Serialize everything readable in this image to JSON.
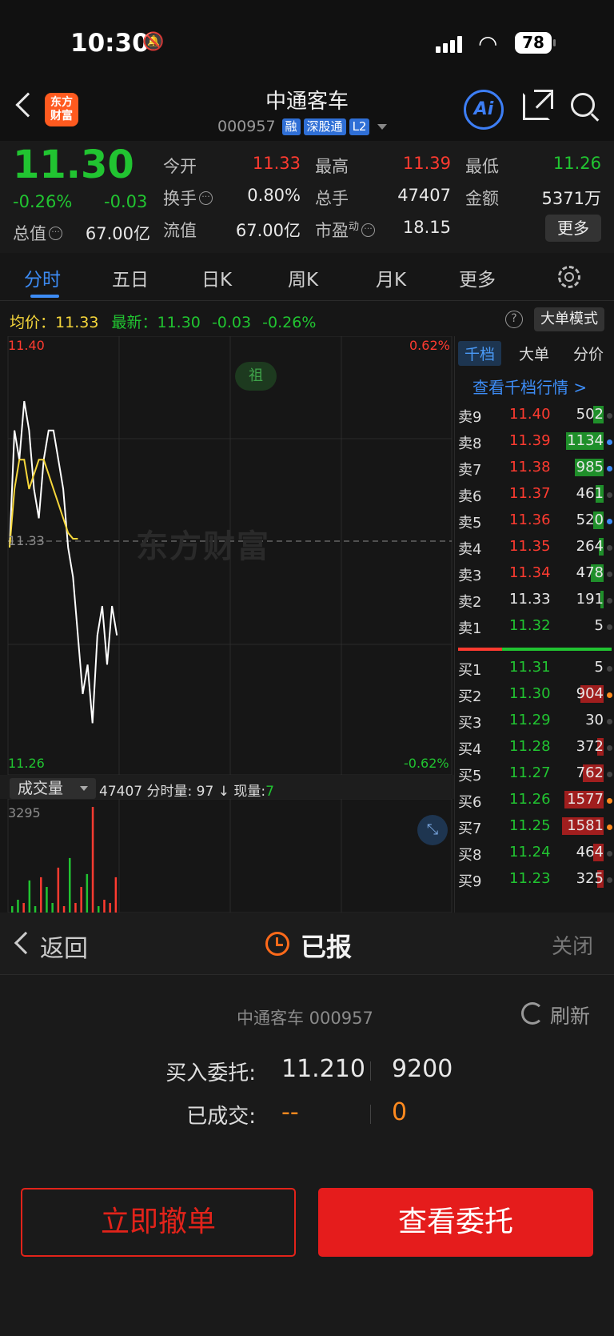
{
  "status_bar": {
    "time": "10:30",
    "battery": "78"
  },
  "header": {
    "logo_top": "东方",
    "logo_bottom": "财富",
    "stock_name": "中通客车",
    "stock_code": "000957",
    "tags": [
      "融",
      "深股通",
      "L2"
    ],
    "ai_label": "Ai"
  },
  "quote": {
    "price": "11.30",
    "change_pct": "-0.26%",
    "change": "-0.03",
    "total_value_label": "总值",
    "total_value": "67.00亿",
    "float_value_label": "流值",
    "float_value": "67.00亿",
    "pe_label": "市盈",
    "pe_sup": "动",
    "pe": "18.15",
    "open_label": "今开",
    "open": "11.33",
    "high_label": "最高",
    "high": "11.39",
    "low_label": "最低",
    "low": "11.26",
    "turnover_label": "换手",
    "turnover": "0.80%",
    "volume_label": "总手",
    "volume": "47407",
    "amount_label": "金额",
    "amount": "5371万",
    "more_label": "更多"
  },
  "tabs": [
    "分时",
    "五日",
    "日K",
    "周K",
    "月K",
    "更多"
  ],
  "avg_row": {
    "avg_label": "均价：",
    "avg_value": "11.33",
    "latest_label": "最新：",
    "latest_value": "11.30",
    "latest_change": "-0.03",
    "latest_pct": "-0.26%",
    "help": "?",
    "big_order_mode": "大单模式"
  },
  "chart": {
    "y_top": "11.40",
    "y_mid": "11.33",
    "y_bottom": "11.26",
    "pct_top": "0.62%",
    "pct_bottom": "-0.62%",
    "badge": "祖",
    "watermark": "东方财富",
    "volume_selector": "成交量",
    "volume_total": "47407",
    "minute_vol_label": "分时量:",
    "minute_vol": "97",
    "arrow": "↓",
    "now_vol_label": "现量:",
    "now_vol": "7",
    "vol_max": "3295",
    "colors": {
      "price_line": "#ffffff",
      "avg_line": "#f5d63b",
      "up": "#ff3b30",
      "down": "#21c431"
    }
  },
  "chart_data": {
    "type": "line",
    "series": [
      {
        "values": [
          11.33,
          11.37,
          11.36,
          11.38,
          11.37,
          11.35,
          11.34,
          11.36,
          11.37,
          11.37,
          11.36,
          11.35,
          11.33,
          11.32,
          11.3,
          11.28,
          11.29,
          11.27,
          11.3,
          11.31,
          11.29,
          11.31,
          11.3
        ]
      },
      {
        "values": [
          11.33,
          11.35,
          11.36,
          11.36,
          11.35,
          11.355,
          11.36,
          11.36,
          11.355,
          11.35,
          11.345,
          11.34,
          11.335,
          11.333,
          11.333
        ]
      }
    ],
    "ylim": [
      11.26,
      11.4
    ],
    "volume": {
      "values": [
        200,
        400,
        300,
        1000,
        200,
        1100,
        800,
        300,
        1400,
        200,
        1700,
        300,
        800,
        1200,
        3295,
        200,
        400,
        300,
        1100
      ],
      "colors": [
        "g",
        "g",
        "r",
        "g",
        "g",
        "r",
        "g",
        "g",
        "r",
        "r",
        "g",
        "r",
        "r",
        "g",
        "r",
        "g",
        "r",
        "r",
        "r"
      ]
    }
  },
  "orderbook": {
    "tabs": [
      "千档",
      "大单",
      "分价"
    ],
    "link": "查看千档行情 >",
    "sell": [
      {
        "label": "卖9",
        "price": "11.40",
        "vol": "502",
        "bar": 0.25,
        "pc": "r",
        "dot": "#444"
      },
      {
        "label": "卖8",
        "price": "11.39",
        "vol": "1134",
        "bar": 0.9,
        "pc": "r",
        "dot": "#3d8cf5"
      },
      {
        "label": "卖7",
        "price": "11.38",
        "vol": "985",
        "bar": 0.7,
        "pc": "r",
        "dot": "#3d8cf5"
      },
      {
        "label": "卖6",
        "price": "11.37",
        "vol": "461",
        "bar": 0.2,
        "pc": "r",
        "dot": "#444"
      },
      {
        "label": "卖5",
        "price": "11.36",
        "vol": "520",
        "bar": 0.25,
        "pc": "r",
        "dot": "#3d8cf5"
      },
      {
        "label": "卖4",
        "price": "11.35",
        "vol": "264",
        "bar": 0.12,
        "pc": "r",
        "dot": "#444"
      },
      {
        "label": "卖3",
        "price": "11.34",
        "vol": "478",
        "bar": 0.3,
        "pc": "r",
        "dot": "#444"
      },
      {
        "label": "卖2",
        "price": "11.33",
        "vol": "191",
        "bar": 0.08,
        "pc": "w",
        "dot": "#444"
      },
      {
        "label": "卖1",
        "price": "11.32",
        "vol": "5",
        "bar": 0,
        "pc": "g",
        "dot": "#444"
      }
    ],
    "buy": [
      {
        "label": "买1",
        "price": "11.31",
        "vol": "5",
        "bar": 0,
        "pc": "g",
        "dot": "#444"
      },
      {
        "label": "买2",
        "price": "11.30",
        "vol": "904",
        "bar": 0.55,
        "pc": "g",
        "dot": "#ff8a1f"
      },
      {
        "label": "买3",
        "price": "11.29",
        "vol": "30",
        "bar": 0,
        "pc": "g",
        "dot": "#444"
      },
      {
        "label": "买4",
        "price": "11.28",
        "vol": "372",
        "bar": 0.15,
        "pc": "g",
        "dot": "#444"
      },
      {
        "label": "买5",
        "price": "11.27",
        "vol": "762",
        "bar": 0.5,
        "pc": "g",
        "dot": "#444"
      },
      {
        "label": "买6",
        "price": "11.26",
        "vol": "1577",
        "bar": 0.95,
        "pc": "g",
        "dot": "#ff8a1f"
      },
      {
        "label": "买7",
        "price": "11.25",
        "vol": "1581",
        "bar": 1.0,
        "pc": "g",
        "dot": "#ff8a1f"
      },
      {
        "label": "买8",
        "price": "11.24",
        "vol": "464",
        "bar": 0.25,
        "pc": "g",
        "dot": "#444"
      },
      {
        "label": "买9",
        "price": "11.23",
        "vol": "325",
        "bar": 0.15,
        "pc": "g",
        "dot": "#444"
      }
    ]
  },
  "sheet": {
    "back": "返回",
    "status": "已报",
    "close": "关闭",
    "stock": "中通客车 000957",
    "refresh": "刷新",
    "buy_label": "买入委托:",
    "buy_price": "11.210",
    "buy_qty": "9200",
    "filled_label": "已成交:",
    "filled_price": "--",
    "filled_qty": "0",
    "cancel_btn": "立即撤单",
    "view_btn": "查看委托"
  }
}
